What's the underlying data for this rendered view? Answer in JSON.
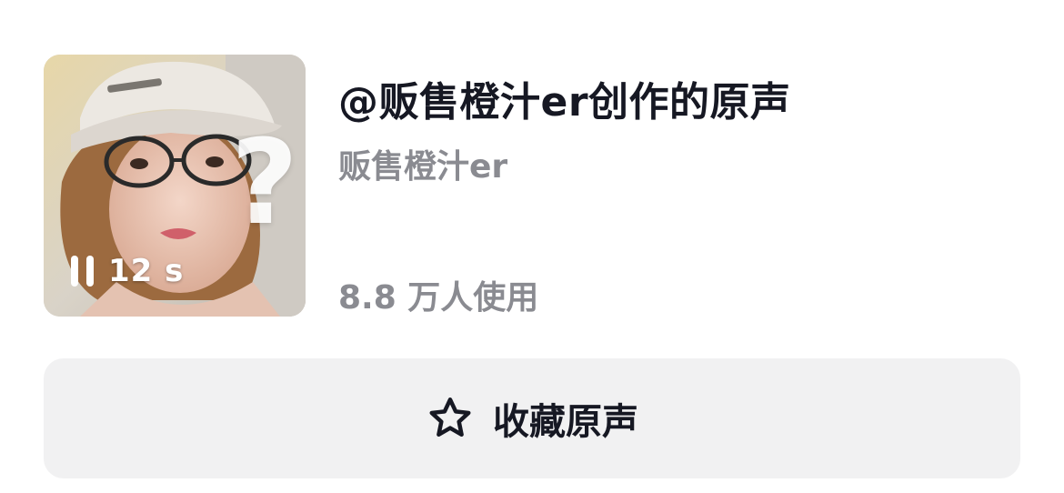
{
  "sound": {
    "title": "@贩售橙汁er创作的原声",
    "author": "贩售橙汁er",
    "usage": "8.8 万人使用",
    "duration": "12 s",
    "cover_overlay_glyph": "?",
    "cover_icon": "pause-icon"
  },
  "actions": {
    "favorite_label": "收藏原声",
    "favorite_icon": "star-outline-icon"
  },
  "colors": {
    "title_text": "#161823",
    "secondary_text": "#8a8b91",
    "button_bg": "#f1f1f2"
  }
}
